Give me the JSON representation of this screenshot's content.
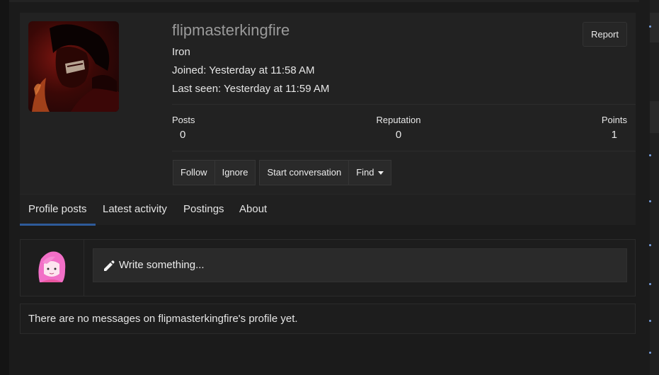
{
  "profile": {
    "username": "flipmasterkingfire",
    "rank": "Iron",
    "joined": "Joined: Yesterday at 11:58 AM",
    "last_seen": "Last seen: Yesterday at 11:59 AM",
    "report_label": "Report",
    "avatar_icon": "user-avatar-dark-character"
  },
  "stats": [
    {
      "label": "Posts",
      "value": "0"
    },
    {
      "label": "Reputation",
      "value": "0"
    },
    {
      "label": "Points",
      "value": "1"
    }
  ],
  "actions": {
    "follow": "Follow",
    "ignore": "Ignore",
    "start_conversation": "Start conversation",
    "find": "Find"
  },
  "tabs": [
    {
      "label": "Profile posts",
      "active": true
    },
    {
      "label": "Latest activity",
      "active": false
    },
    {
      "label": "Postings",
      "active": false
    },
    {
      "label": "About",
      "active": false
    }
  ],
  "composer": {
    "placeholder": "Write something...",
    "icon": "pencil-icon",
    "avatar_icon": "pink-haired-avatar"
  },
  "empty_message": "There are no messages on flipmasterkingfire's profile yet.",
  "colors": {
    "background": "#1b1b1b",
    "panel": "#222222",
    "accent": "#2e5b9a",
    "username": "#9a9a9a"
  }
}
